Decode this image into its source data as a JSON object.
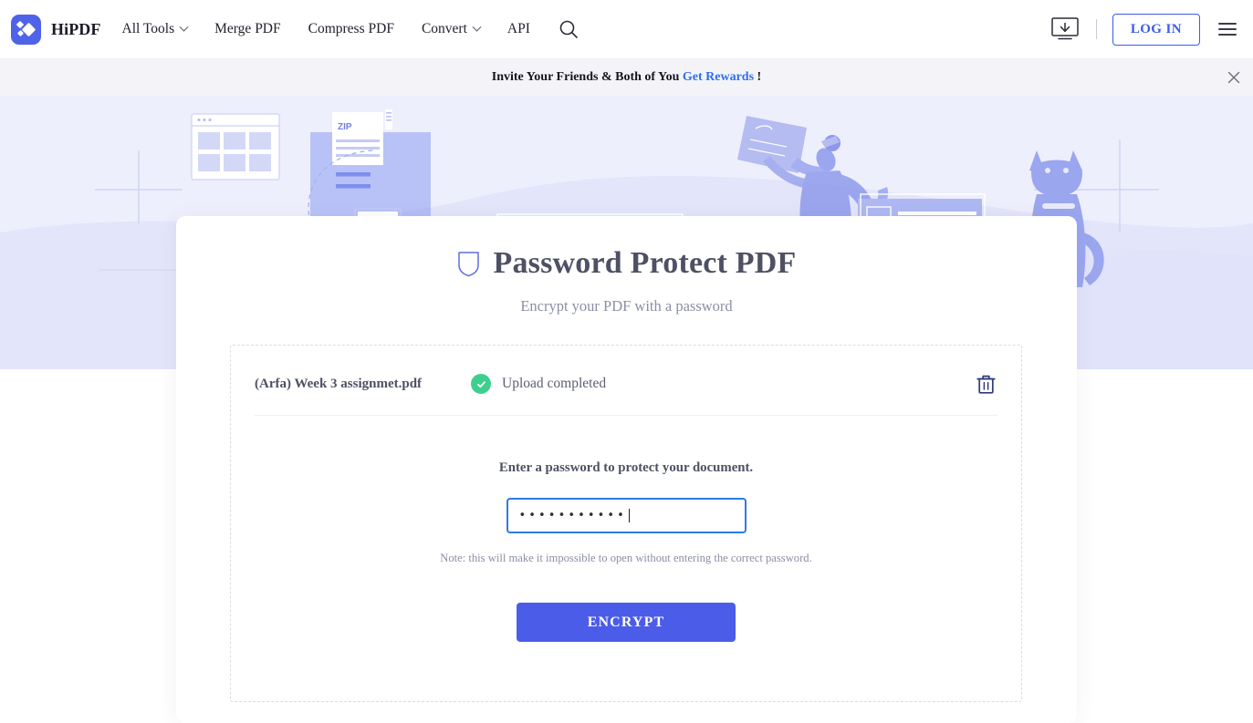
{
  "header": {
    "brand": "HiPDF",
    "logo_icon": "hipdf-logo-icon",
    "nav": [
      {
        "label": "All Tools",
        "has_caret": true
      },
      {
        "label": "Merge PDF",
        "has_caret": false
      },
      {
        "label": "Compress PDF",
        "has_caret": false
      },
      {
        "label": "Convert",
        "has_caret": true
      },
      {
        "label": "API",
        "has_caret": false
      }
    ],
    "search_icon": "search-icon",
    "desktop_download_icon": "desktop-download-icon",
    "login_label": "LOG IN",
    "menu_icon": "hamburger-menu-icon"
  },
  "banner": {
    "text_before": "Invite Your Friends & Both of You",
    "link_label": "Get Rewards",
    "text_after": "!",
    "close_icon": "close-icon"
  },
  "hero": {
    "background_color": "#eeeffc",
    "illustration_items": [
      "browser-window-grid",
      "zip-file",
      "word-document",
      "excel-file",
      "browser-window-chart",
      "person-holding-document",
      "pdf-bar",
      "lightbulb-card",
      "image-card",
      "cat-silhouette"
    ]
  },
  "card": {
    "title": "Password Protect PDF",
    "title_icon": "shield-icon",
    "subtitle": "Encrypt your PDF with a password",
    "file": {
      "name": "(Arfa) Week 3 assignmet.pdf",
      "status": "Upload completed",
      "status_icon": "check-circle-icon",
      "status_color": "#3ecf8e",
      "delete_icon": "trash-icon"
    },
    "password": {
      "label": "Enter a password to protect your document.",
      "value": "•••••••••••",
      "placeholder": "",
      "note": "Note: this will make it impossible to open without entering the correct password.",
      "focus_color": "#2f7ae5"
    },
    "encrypt_label": "ENCRYPT",
    "encrypt_color": "#4b5ce8"
  }
}
